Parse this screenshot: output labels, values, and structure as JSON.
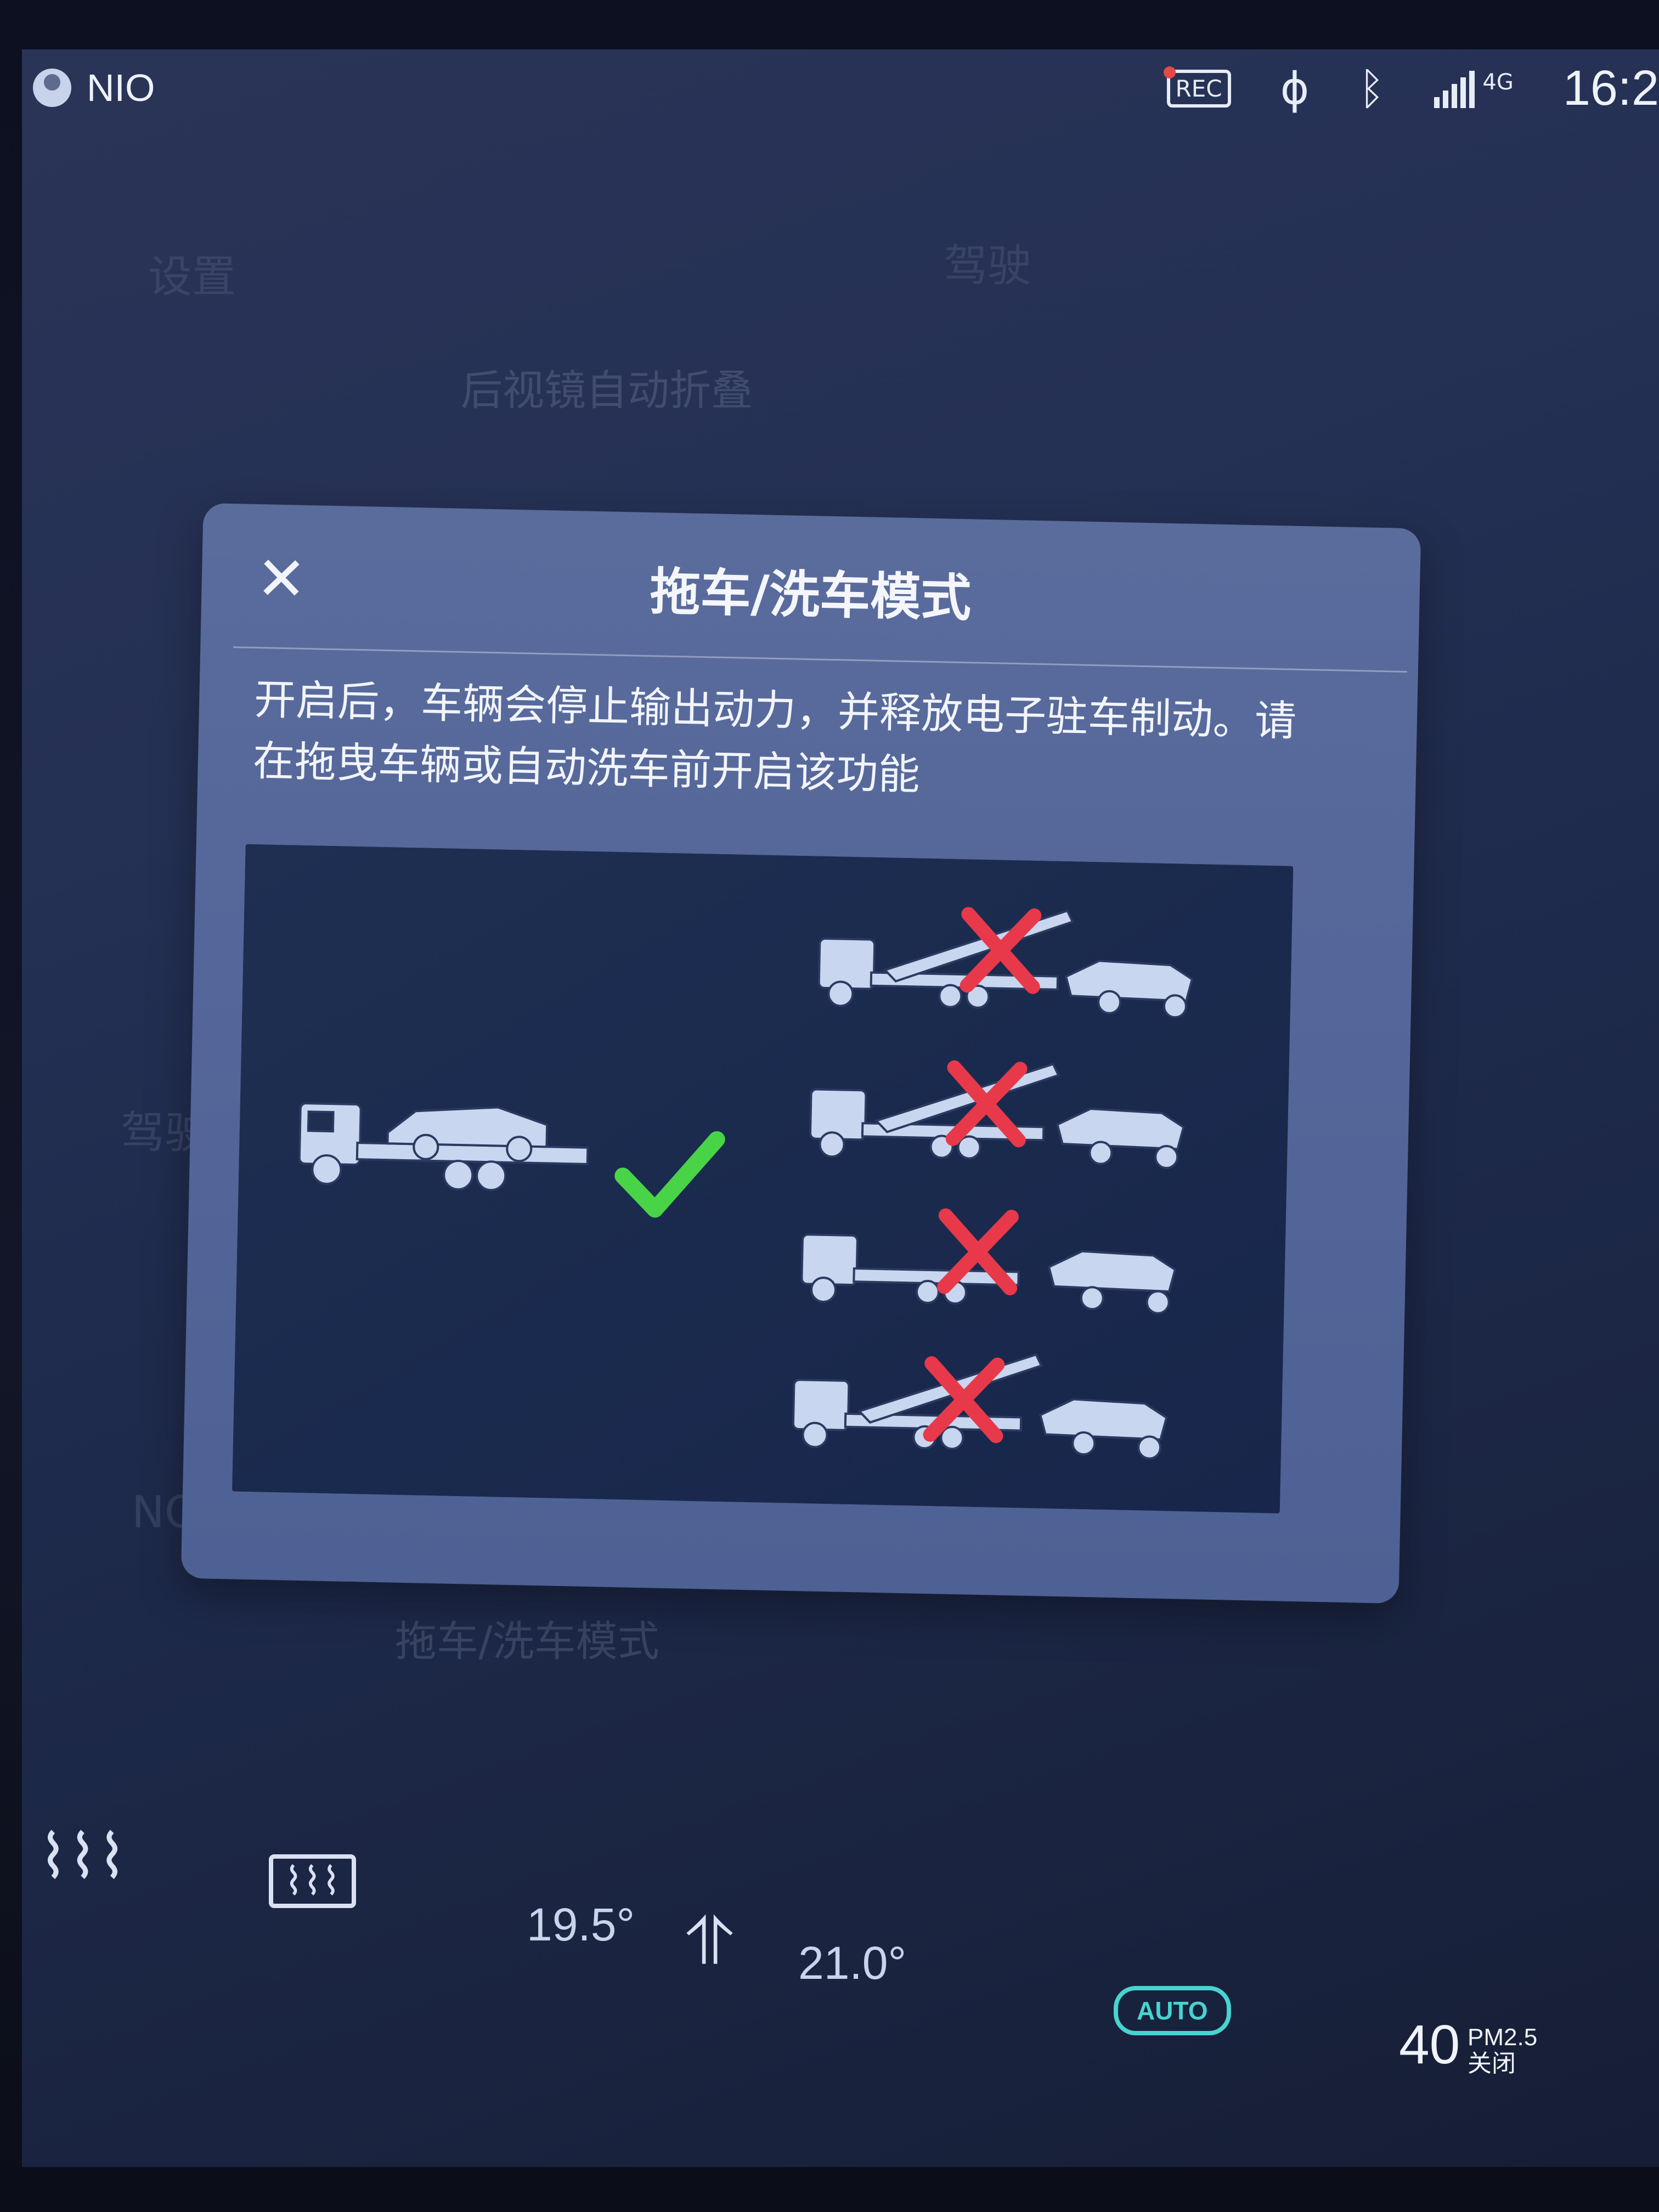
{
  "status_bar": {
    "profile_label": "NIO",
    "rec_label": "REC",
    "network_label": "4G",
    "time": "16:2"
  },
  "background_ui": {
    "tab_left": "设置",
    "tab_right": "驾驶",
    "setting_row": "后视镜自动折叠",
    "side_item_drive": "驾驶",
    "side_item_nomi": "NOMI",
    "tow_row_label": "拖车/洗车模式"
  },
  "modal": {
    "title": "拖车/洗车模式",
    "description": "开启后，车辆会停止输出动力，并释放电子驻车制动。请在拖曳车辆或自动洗车前开启该功能",
    "illustration": {
      "allowed_method": "flatbed",
      "disallowed_count": 4
    }
  },
  "climate": {
    "left_temp": "19.5°",
    "right_temp": "21.0°",
    "auto_label": "AUTO",
    "pm_value": "40",
    "pm_label": "PM2.5",
    "pm_status": "关闭"
  },
  "colors": {
    "check": "#49d448",
    "cross": "#e8394a",
    "auto": "#48d3d0"
  }
}
